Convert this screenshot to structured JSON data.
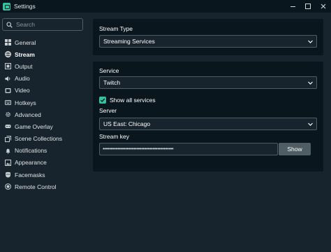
{
  "window": {
    "title": "Settings"
  },
  "search": {
    "placeholder": "Search"
  },
  "sidebar": {
    "items": [
      {
        "label": "General",
        "icon": "grid-icon"
      },
      {
        "label": "Stream",
        "icon": "globe-icon"
      },
      {
        "label": "Output",
        "icon": "output-icon"
      },
      {
        "label": "Audio",
        "icon": "speaker-icon"
      },
      {
        "label": "Video",
        "icon": "video-icon"
      },
      {
        "label": "Hotkeys",
        "icon": "keyboard-icon"
      },
      {
        "label": "Advanced",
        "icon": "gear-icon"
      },
      {
        "label": "Game Overlay",
        "icon": "gamepad-icon"
      },
      {
        "label": "Scene Collections",
        "icon": "collections-icon"
      },
      {
        "label": "Notifications",
        "icon": "bell-icon"
      },
      {
        "label": "Appearance",
        "icon": "image-icon"
      },
      {
        "label": "Facemasks",
        "icon": "mask-icon"
      },
      {
        "label": "Remote Control",
        "icon": "remote-icon"
      }
    ],
    "active": "Stream"
  },
  "stream_type": {
    "label": "Stream Type",
    "value": "Streaming Services"
  },
  "service": {
    "label": "Service",
    "value": "Twitch",
    "show_all_label": "Show all services",
    "show_all_checked": true
  },
  "server": {
    "label": "Server",
    "value": "US East: Chicago"
  },
  "stream_key": {
    "label": "Stream key",
    "masked_value": "••••••••••••••••••••••••••••••••••••••••••••",
    "show_label": "Show"
  },
  "colors": {
    "accent": "#31c3a2",
    "background": "#17242d",
    "panel": "#09161d",
    "border": "#4f5e65"
  }
}
